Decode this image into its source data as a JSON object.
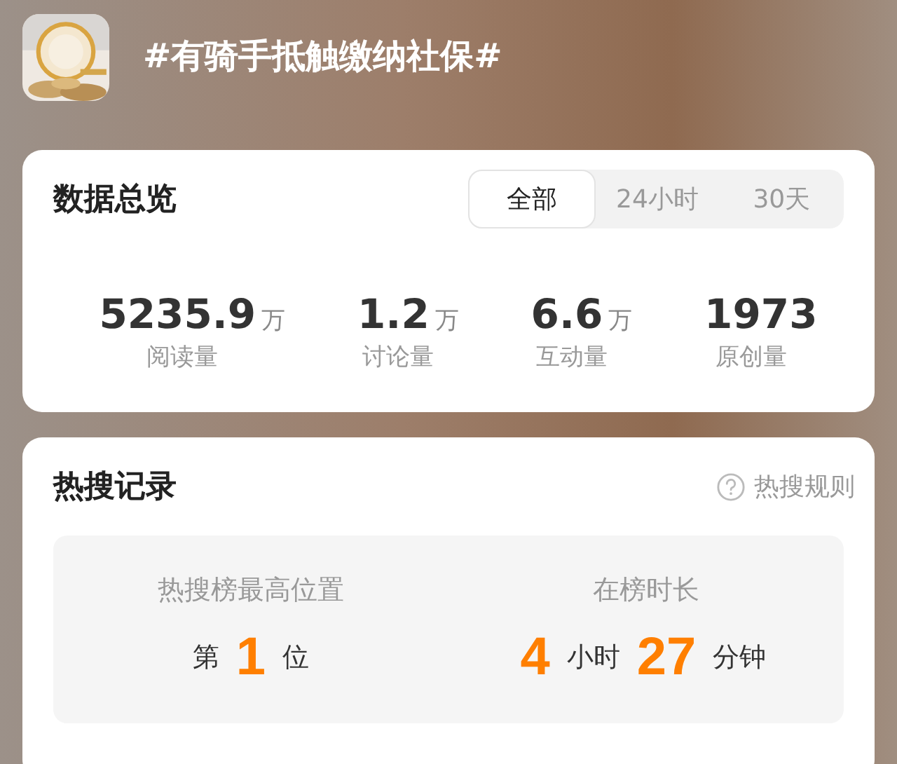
{
  "topic": {
    "title": "#有骑手抵触缴纳社保#"
  },
  "overview": {
    "title": "数据总览",
    "tabs": [
      {
        "label": "全部",
        "selected": true
      },
      {
        "label": "24小时",
        "selected": false
      },
      {
        "label": "30天",
        "selected": false
      }
    ],
    "stats": [
      {
        "value": "5235.9",
        "unit": "万",
        "label": "阅读量"
      },
      {
        "value": "1.2",
        "unit": "万",
        "label": "讨论量"
      },
      {
        "value": "6.6",
        "unit": "万",
        "label": "互动量"
      },
      {
        "value": "1973",
        "label": "原创量"
      }
    ]
  },
  "hot_search": {
    "title": "热搜记录",
    "rules_link": "热搜规则",
    "records": [
      {
        "label": "热搜榜最高位置",
        "parts": [
          {
            "kind": "unit",
            "text": "第"
          },
          {
            "kind": "number",
            "text": "1"
          },
          {
            "kind": "unit",
            "text": "位"
          }
        ]
      },
      {
        "label": "在榜时长",
        "parts": [
          {
            "kind": "number",
            "text": "4"
          },
          {
            "kind": "unit",
            "text": "小时"
          },
          {
            "kind": "number",
            "text": "27"
          },
          {
            "kind": "unit",
            "text": "分钟"
          }
        ]
      }
    ]
  }
}
